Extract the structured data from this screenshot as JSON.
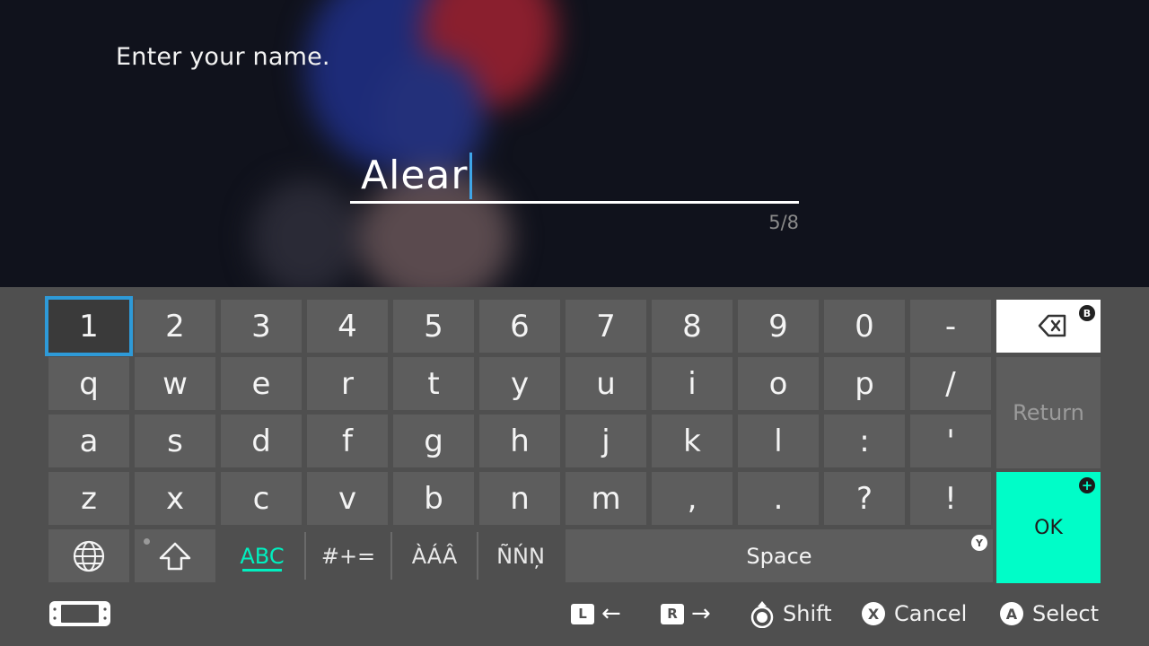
{
  "prompt": "Enter your name.",
  "name_field": {
    "value": "Alear",
    "count": "5/8"
  },
  "keyboard": {
    "row_numbers": [
      "1",
      "2",
      "3",
      "4",
      "5",
      "6",
      "7",
      "8",
      "9",
      "0",
      "-"
    ],
    "row_q": [
      "q",
      "w",
      "e",
      "r",
      "t",
      "y",
      "u",
      "i",
      "o",
      "p",
      "/"
    ],
    "row_a": [
      "a",
      "s",
      "d",
      "f",
      "g",
      "h",
      "j",
      "k",
      "l",
      ":",
      "'"
    ],
    "row_z": [
      "z",
      "x",
      "c",
      "v",
      "b",
      "n",
      "m",
      ",",
      ".",
      "?",
      "!"
    ],
    "selected_key": "1",
    "return_label": "Return",
    "ok_label": "OK",
    "space_label": "Space",
    "backspace_badge": "B",
    "ok_badge": "+",
    "space_badge": "Y",
    "modes": {
      "abc": "ABC",
      "symbols": "#+=",
      "accents": "ÀÁÂ",
      "accents2": "ÑŃŅ"
    },
    "accent_color": "#00fdc8",
    "selection_color": "#2e9ad8"
  },
  "footer": {
    "l_button": "L",
    "r_button": "R",
    "shift_label": "Shift",
    "x_button": "X",
    "cancel_label": "Cancel",
    "a_button": "A",
    "select_label": "Select"
  }
}
